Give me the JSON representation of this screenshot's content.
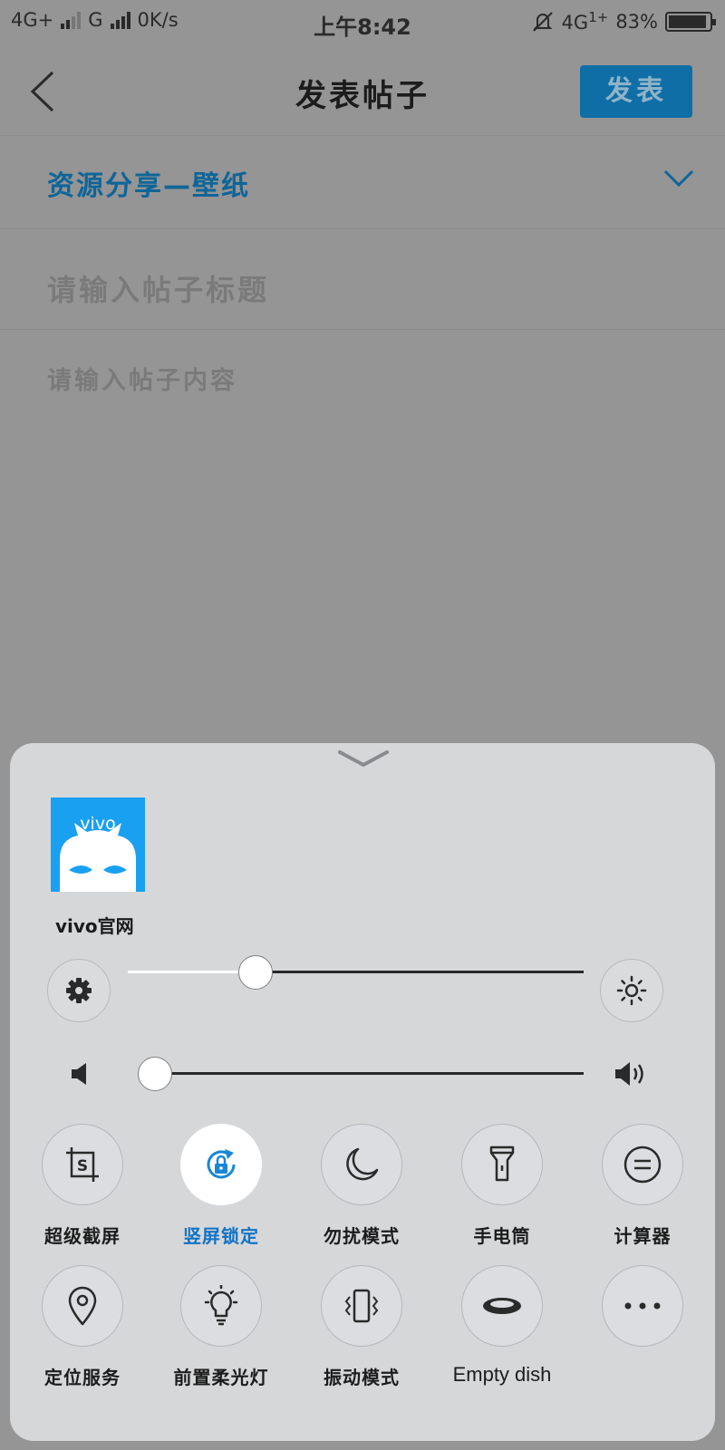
{
  "status_bar": {
    "network_1": "4G+",
    "network_2": "G",
    "speed": "0K/s",
    "time": "上午8:42",
    "network_3": "4G",
    "network_3_sup": "1+",
    "battery": "83%"
  },
  "nav": {
    "title": "发表帖子",
    "publish_label": "发表"
  },
  "form": {
    "category": "资源分享—壁纸",
    "title_placeholder": "请输入帖子标题",
    "content_placeholder": "请输入帖子内容"
  },
  "control_center": {
    "app": {
      "label": "vivo官网",
      "tile_text": "vivo"
    },
    "brightness_level": 0.28,
    "volume_level": 0.03,
    "toggles": [
      {
        "label": "超级截屏",
        "icon": "screenshot-icon",
        "active": false
      },
      {
        "label": "竖屏锁定",
        "icon": "rotation-lock-icon",
        "active": true
      },
      {
        "label": "勿扰模式",
        "icon": "moon-icon",
        "active": false
      },
      {
        "label": "手电筒",
        "icon": "flashlight-icon",
        "active": false
      },
      {
        "label": "计算器",
        "icon": "calculator-icon",
        "active": false
      },
      {
        "label": "定位服务",
        "icon": "location-pin-icon",
        "active": false
      },
      {
        "label": "前置柔光灯",
        "icon": "light-bulb-icon",
        "active": false
      },
      {
        "label": "振动模式",
        "icon": "vibration-icon",
        "active": false
      },
      {
        "label": "Empty dish",
        "icon": "dish-icon",
        "active": false
      },
      {
        "label": "",
        "icon": "more-icon",
        "active": false
      }
    ],
    "colors": {
      "accent": "#1273c4",
      "panel": "#d6d7d9"
    }
  }
}
